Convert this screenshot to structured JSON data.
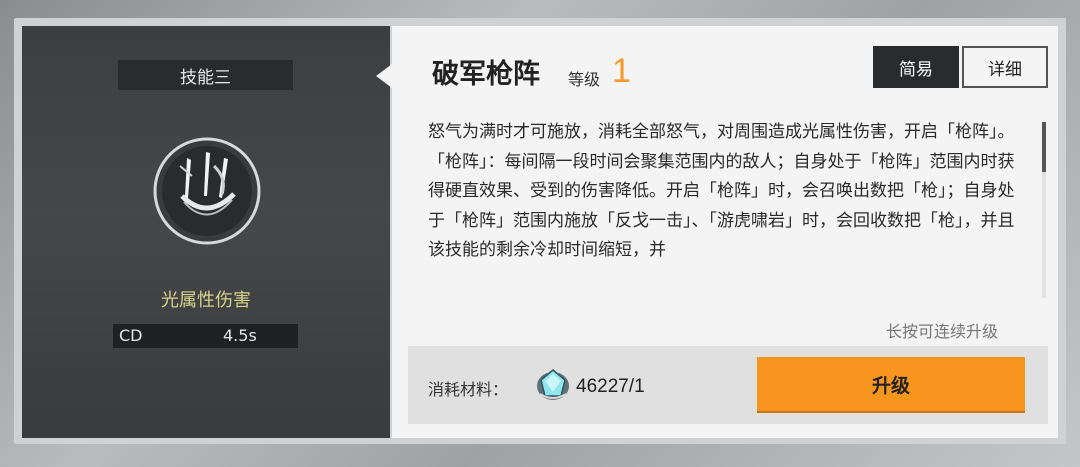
{
  "skill_panel": {
    "slot_label": "技能三",
    "icon": "spear-array-icon",
    "damage_type": "光属性伤害",
    "cd_label": "CD",
    "cd_value": "4.5s"
  },
  "detail_panel": {
    "skill_name": "破军枪阵",
    "level_label": "等级",
    "level_value": "1",
    "tabs": [
      {
        "label": "简易",
        "active": true
      },
      {
        "label": "详细",
        "active": false
      }
    ],
    "description": [
      "怒气为满时才可施放，消耗全部怒气，对周围造成光属性伤害，开启「枪阵」。",
      "「枪阵」：每间隔一段时间会聚集范围内的敌人；自身处于「枪阵」范围内时获得硬直效果、受到的伤害降低。开启「枪阵」时，会召唤出数把「枪」；自身处于「枪阵」范围内施放「反戈一击」、「游虎啸岩」时，会回收数把「枪」，并且该技能的剩余冷却时间缩短，并"
    ],
    "hold_hint": "长按可连续升级",
    "material_label": "消耗材料：",
    "material_icon": "crystal-material-icon",
    "material_count": "46227/1",
    "upgrade_label": "升级"
  },
  "colors": {
    "accent_orange": "#f7951e",
    "level_orange": "#f29a2a",
    "damage_type_yellow": "#d7d38a"
  }
}
